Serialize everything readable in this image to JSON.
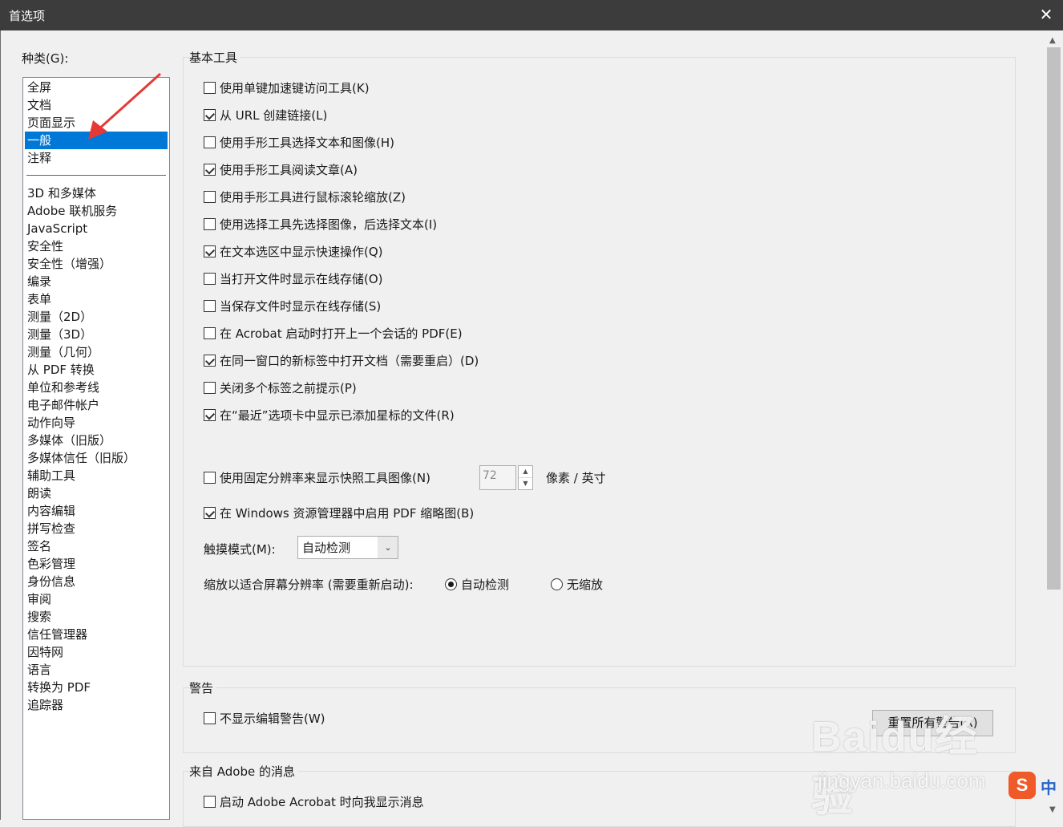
{
  "window": {
    "title": "首选项",
    "close_glyph": "✕"
  },
  "categories": {
    "label": "种类(G):",
    "top_items": [
      "全屏",
      "文档",
      "页面显示",
      "一般",
      "注释"
    ],
    "selected": "一般",
    "items": [
      "3D 和多媒体",
      "Adobe 联机服务",
      "JavaScript",
      "安全性",
      "安全性（增强）",
      "编录",
      "表单",
      "测量（2D）",
      "测量（3D）",
      "测量（几何）",
      "从 PDF 转换",
      "单位和参考线",
      "电子邮件帐户",
      "动作向导",
      "多媒体（旧版）",
      "多媒体信任（旧版）",
      "辅助工具",
      "朗读",
      "内容编辑",
      "拼写检查",
      "签名",
      "色彩管理",
      "身份信息",
      "审阅",
      "搜索",
      "信任管理器",
      "因特网",
      "语言",
      "转换为 PDF",
      "追踪器"
    ]
  },
  "basic_tools": {
    "title": "基本工具",
    "options": [
      {
        "label": "使用单键加速键访问工具(K)",
        "checked": false
      },
      {
        "label": "从 URL 创建链接(L)",
        "checked": true
      },
      {
        "label": "使用手形工具选择文本和图像(H)",
        "checked": false
      },
      {
        "label": "使用手形工具阅读文章(A)",
        "checked": true
      },
      {
        "label": "使用手形工具进行鼠标滚轮缩放(Z)",
        "checked": false
      },
      {
        "label": "使用选择工具先选择图像，后选择文本(I)",
        "checked": false
      },
      {
        "label": "在文本选区中显示快速操作(Q)",
        "checked": true
      },
      {
        "label": "当打开文件时显示在线存储(O)",
        "checked": false
      },
      {
        "label": "当保存文件时显示在线存储(S)",
        "checked": false
      },
      {
        "label": "在 Acrobat 启动时打开上一个会话的 PDF(E)",
        "checked": false
      },
      {
        "label": "在同一窗口的新标签中打开文档（需要重启）(D)",
        "checked": true
      },
      {
        "label": "关闭多个标签之前提示(P)",
        "checked": false
      },
      {
        "label": "在“最近”选项卡中显示已添加星标的文件(R)",
        "checked": true
      }
    ],
    "fixed_resolution": {
      "label": "使用固定分辨率来显示快照工具图像(N)",
      "checked": false,
      "value": "72",
      "unit": "像素 / 英寸"
    },
    "thumbnails": {
      "label": "在 Windows 资源管理器中启用 PDF 缩略图(B)",
      "checked": true
    },
    "touch_mode": {
      "label": "触摸模式(M):",
      "value": "自动检测"
    },
    "scale": {
      "label": "缩放以适合屏幕分辨率 (需要重新启动):",
      "options": [
        {
          "label": "自动检测",
          "selected": true
        },
        {
          "label": "无缩放",
          "selected": false
        }
      ]
    }
  },
  "warnings": {
    "title": "警告",
    "option": {
      "label": "不显示编辑警告(W)",
      "checked": false
    },
    "reset_button": "重置所有警告(R)"
  },
  "adobe_messages": {
    "title": "来自 Adobe 的消息",
    "option": {
      "label": "启动 Adobe Acrobat 时向我显示消息",
      "checked": false
    }
  },
  "watermark": {
    "logo": "Baidu经验",
    "url": "jingyan.baidu.com"
  },
  "ime": {
    "s": "S",
    "lang": "中"
  },
  "colors": {
    "selection": "#0078d7",
    "annotation_arrow": "#e53935"
  }
}
